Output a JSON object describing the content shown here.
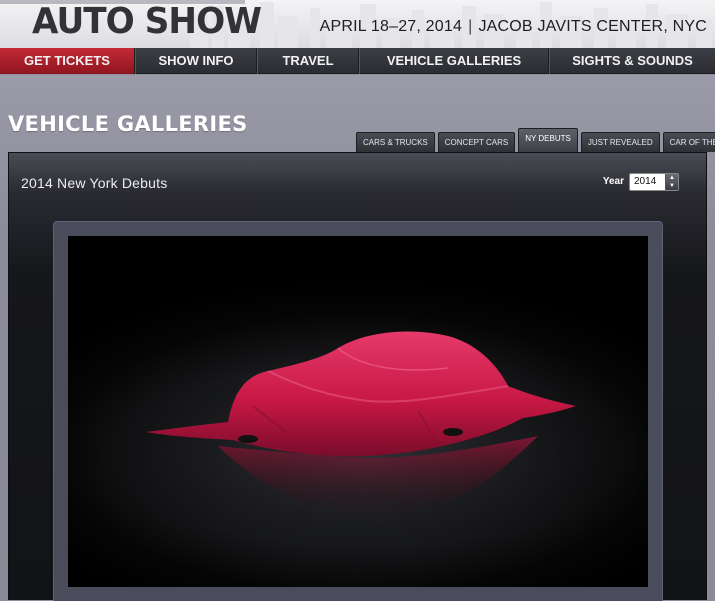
{
  "header": {
    "logo_text": "AUTO SHOW",
    "event_dates": "APRIL 18–27, 2014",
    "event_separator": "|",
    "event_venue": "JACOB JAVITS CENTER, NYC"
  },
  "nav": {
    "items": [
      {
        "label": "GET TICKETS"
      },
      {
        "label": "SHOW INFO"
      },
      {
        "label": "TRAVEL"
      },
      {
        "label": "VEHICLE GALLERIES"
      },
      {
        "label": "SIGHTS & SOUNDS"
      }
    ],
    "active_index": 0
  },
  "page": {
    "title": "VEHICLE GALLERIES"
  },
  "tabs": {
    "items": [
      {
        "label": "CARS & TRUCKS"
      },
      {
        "label": "CONCEPT CARS"
      },
      {
        "label": "NY DEBUTS"
      },
      {
        "label": "JUST REVEALED"
      },
      {
        "label": "CAR OF THE YEAR"
      }
    ],
    "active_index": 2
  },
  "gallery": {
    "title": "2014 New York Debuts",
    "year_label": "Year",
    "year_value": "2014",
    "image_subject": "covered-car-photo"
  },
  "colors": {
    "accent_red": "#b0202b",
    "cover_red": "#d81f4f",
    "nav_bg": "#33353b"
  },
  "icons": {
    "spinner": "up-down-arrows-icon"
  }
}
